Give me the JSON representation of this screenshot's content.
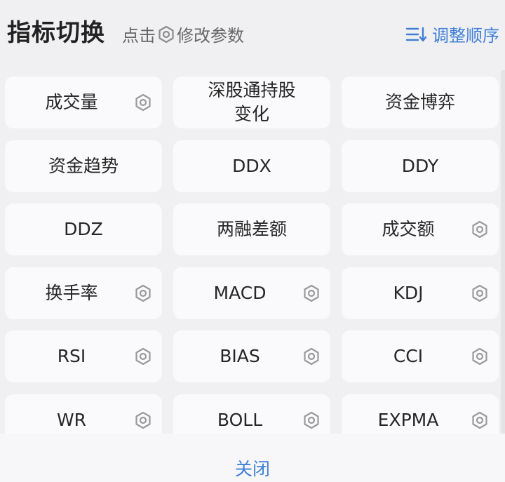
{
  "header": {
    "title": "指标切换",
    "hint_prefix": "点击",
    "hint_suffix": "修改参数",
    "sort_label": "调整顺序",
    "sort_icon": "sort-list-icon",
    "hint_icon": "gear-icon"
  },
  "indicators": [
    {
      "label": "成交量",
      "has_settings": true
    },
    {
      "label": "深股通持股\n变化",
      "has_settings": false
    },
    {
      "label": "资金博弈",
      "has_settings": false
    },
    {
      "label": "资金趋势",
      "has_settings": false
    },
    {
      "label": "DDX",
      "has_settings": false
    },
    {
      "label": "DDY",
      "has_settings": false
    },
    {
      "label": "DDZ",
      "has_settings": false
    },
    {
      "label": "两融差额",
      "has_settings": false
    },
    {
      "label": "成交额",
      "has_settings": true
    },
    {
      "label": "换手率",
      "has_settings": true
    },
    {
      "label": "MACD",
      "has_settings": true
    },
    {
      "label": "KDJ",
      "has_settings": true
    },
    {
      "label": "RSI",
      "has_settings": true
    },
    {
      "label": "BIAS",
      "has_settings": true
    },
    {
      "label": "CCI",
      "has_settings": true
    },
    {
      "label": "WR",
      "has_settings": true
    },
    {
      "label": "BOLL",
      "has_settings": true
    },
    {
      "label": "EXPMA",
      "has_settings": true
    }
  ],
  "footer": {
    "close_label": "关闭"
  },
  "colors": {
    "accent": "#3f7fd8",
    "background": "#f0f0f2",
    "card": "#fafafc",
    "gear": "#9a9a9a"
  }
}
